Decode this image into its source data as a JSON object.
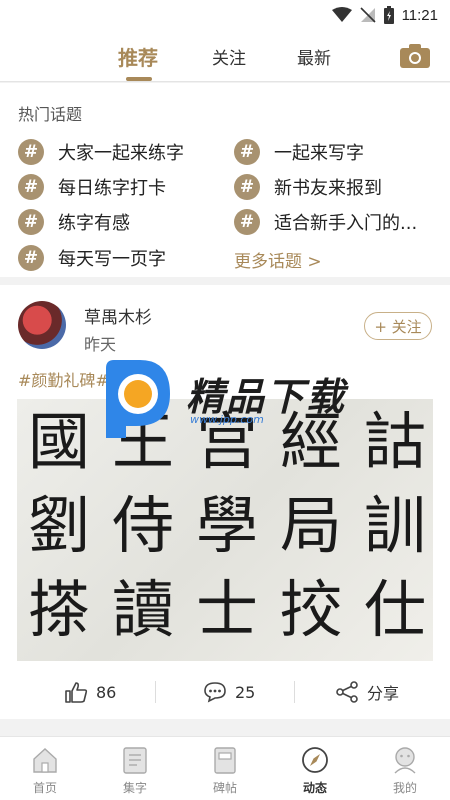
{
  "status_bar": {
    "time": "11:21"
  },
  "top_tabs": {
    "items": [
      "推荐",
      "关注",
      "最新"
    ],
    "active": "推荐"
  },
  "hot_topics": {
    "title": "热门话题",
    "items": [
      "大家一起来练字",
      "一起来写字",
      "每日练字打卡",
      "新书友来报到",
      "练字有感",
      "适合新手入门的...",
      "每天写一页字"
    ],
    "more_label": "更多话题 >"
  },
  "post": {
    "author": "草禺木杉",
    "time": "昨天",
    "follow_label": "+ 关注",
    "tag": "#颜勤礼碑#",
    "calligraphy_rows": [
      [
        "國",
        "王",
        "宫",
        "經",
        "詁"
      ],
      [
        "劉",
        "侍",
        "學",
        "局",
        "訓"
      ],
      [
        "搽",
        "讀",
        "士",
        "挍",
        "仕"
      ]
    ],
    "likes": "86",
    "comments": "25",
    "share_label": "分享"
  },
  "watermark": {
    "title": "精品下载",
    "url": "www.jpp.com"
  },
  "bottom_tabs": {
    "items": [
      "首页",
      "集字",
      "碑帖",
      "动态",
      "我的"
    ],
    "active": "动态"
  },
  "colors": {
    "accent": "#a88959",
    "hashtag_bg": "#a89270"
  }
}
